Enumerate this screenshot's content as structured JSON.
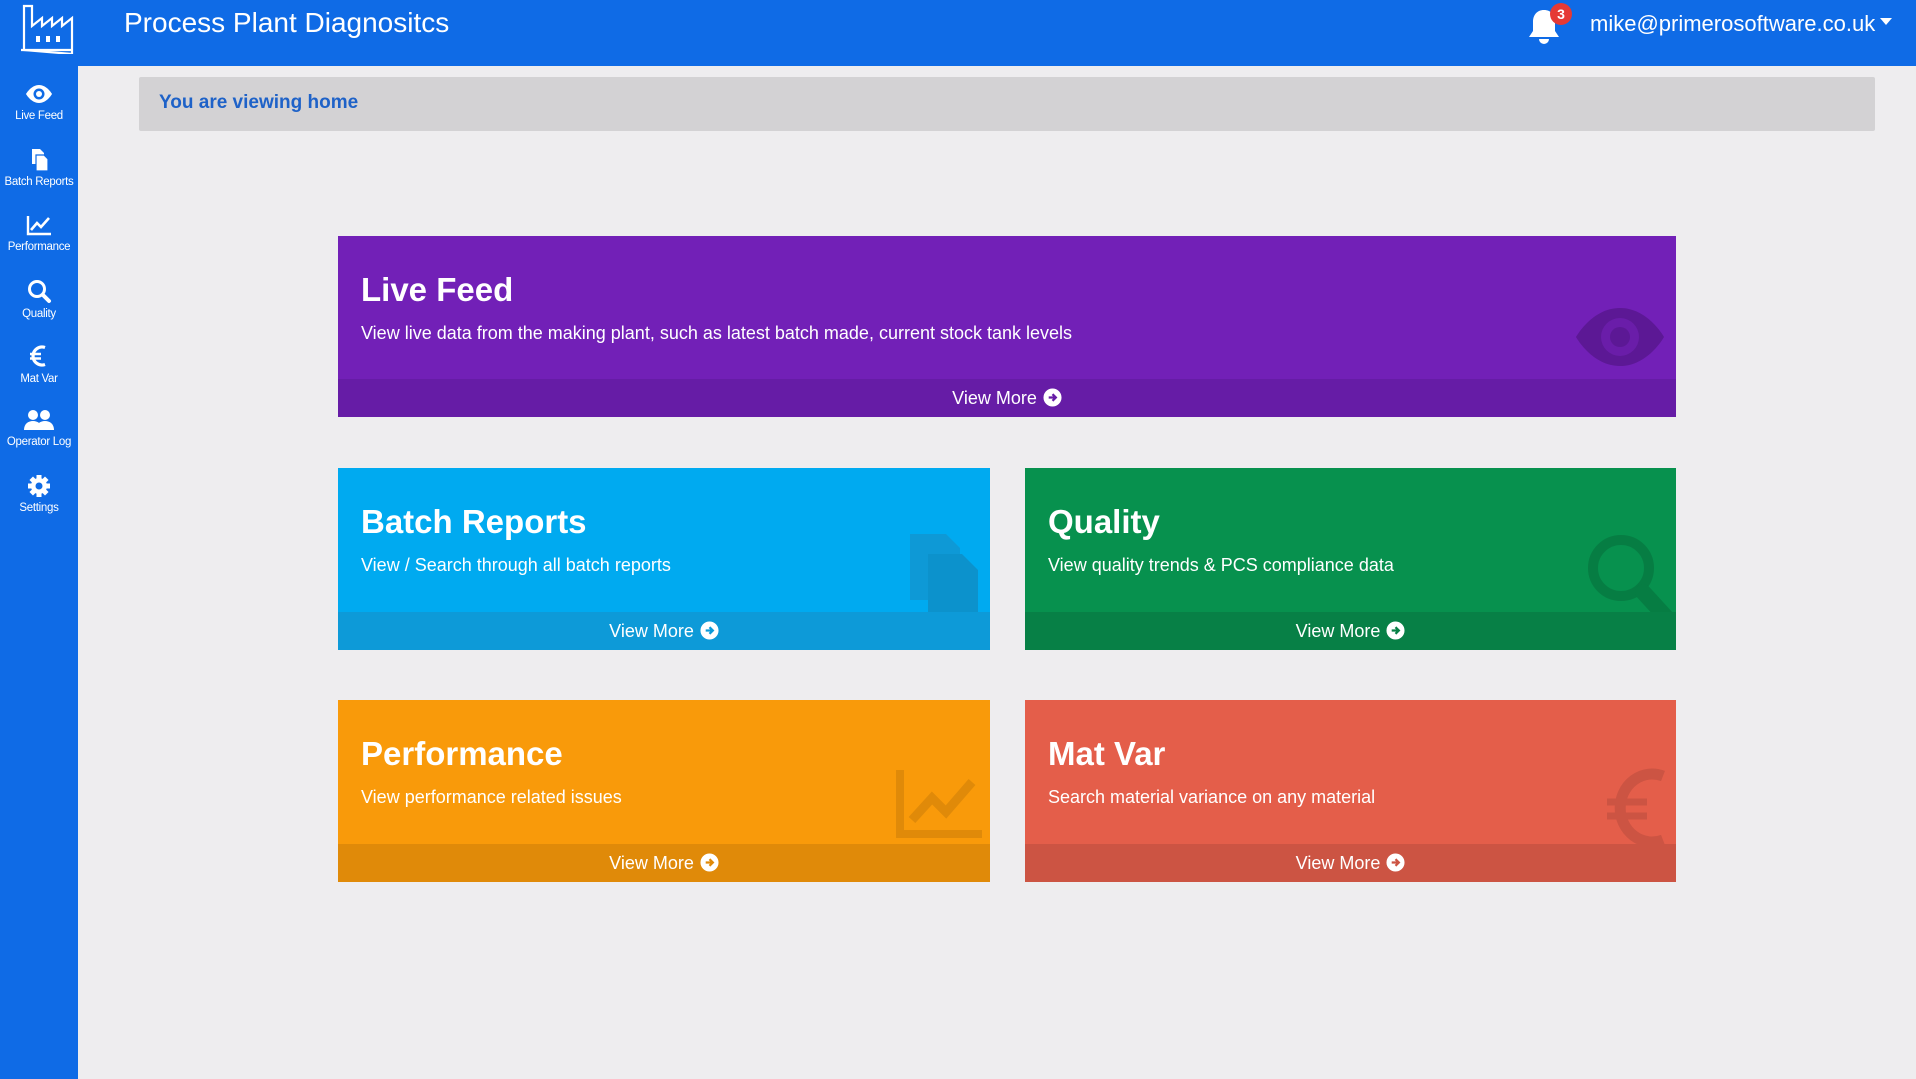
{
  "header": {
    "app_title": "Process Plant Diagnositcs",
    "notification_count": "3",
    "user_email": "mike@primerosoftware.co.uk"
  },
  "sidebar": {
    "items": [
      {
        "label": "Live Feed",
        "icon": "eye-icon"
      },
      {
        "label": "Batch Reports",
        "icon": "files-icon"
      },
      {
        "label": "Performance",
        "icon": "line-chart-icon"
      },
      {
        "label": "Quality",
        "icon": "search-icon"
      },
      {
        "label": "Mat Var",
        "icon": "euro-icon"
      },
      {
        "label": "Operator Log",
        "icon": "users-icon"
      },
      {
        "label": "Settings",
        "icon": "gear-icon"
      }
    ]
  },
  "breadcrumb": {
    "text": "You are viewing home"
  },
  "cards": [
    {
      "title": "Live Feed",
      "description": "View live data from the making plant, such as latest batch made, current stock tank levels",
      "link": "View More",
      "color": "#7220b7",
      "icon": "eye-icon"
    },
    {
      "title": "Batch Reports",
      "description": "View / Search through all batch reports",
      "link": "View More",
      "color": "#00aaf0",
      "icon": "files-icon"
    },
    {
      "title": "Quality",
      "description": "View quality trends & PCS compliance data",
      "link": "View More",
      "color": "#07914e",
      "icon": "search-icon"
    },
    {
      "title": "Performance",
      "description": "View performance related issues",
      "link": "View More",
      "color": "#f99a0a",
      "icon": "line-chart-icon"
    },
    {
      "title": "Mat Var",
      "description": "Search material variance on any material",
      "link": "View More",
      "color": "#e45e4a",
      "icon": "euro-icon"
    }
  ],
  "colors": {
    "primary": "#0f6be6",
    "breadcrumb_bg": "#d3d2d4",
    "page_bg": "#eeedef"
  }
}
